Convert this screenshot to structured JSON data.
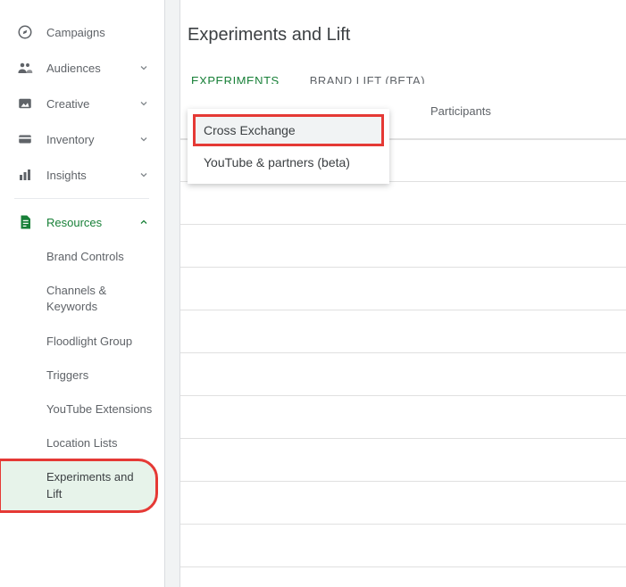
{
  "sidebar": {
    "items": [
      {
        "label": "Campaigns",
        "icon": "compass",
        "expandable": false
      },
      {
        "label": "Audiences",
        "icon": "people",
        "expandable": true
      },
      {
        "label": "Creative",
        "icon": "image",
        "expandable": true
      },
      {
        "label": "Inventory",
        "icon": "card",
        "expandable": true
      },
      {
        "label": "Insights",
        "icon": "bar",
        "expandable": true
      }
    ],
    "section": {
      "label": "Resources",
      "icon": "doc",
      "expanded": true,
      "children": [
        {
          "label": "Brand Controls"
        },
        {
          "label": "Channels & Keywords"
        },
        {
          "label": "Floodlight Group"
        },
        {
          "label": "Triggers"
        },
        {
          "label": "YouTube Extensions"
        },
        {
          "label": "Location Lists"
        },
        {
          "label": "Experiments and Lift"
        }
      ]
    }
  },
  "page": {
    "title": "Experiments and Lift",
    "tabs": [
      {
        "label": "Experiments",
        "active": true
      },
      {
        "label": "Brand Lift (Beta)",
        "active": false
      }
    ]
  },
  "menu": {
    "items": [
      {
        "label": "Cross Exchange",
        "highlight": true,
        "hover": true
      },
      {
        "label": "YouTube & partners (beta)",
        "highlight": false,
        "hover": false
      }
    ]
  },
  "table": {
    "columns": [
      "Participants"
    ]
  }
}
